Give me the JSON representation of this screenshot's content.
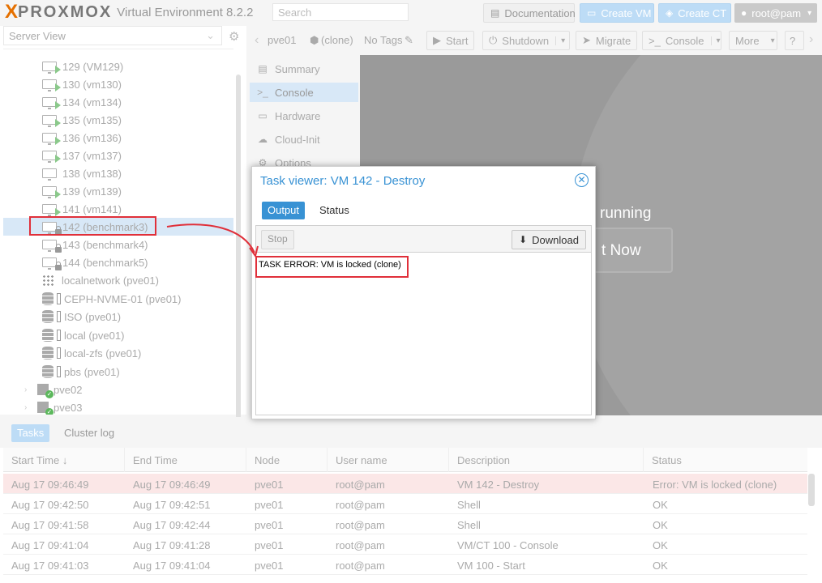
{
  "header": {
    "logo_x": "X",
    "logo_brand": "PROXMOX",
    "product": "Virtual Environment 8.2.2",
    "search_placeholder": "Search",
    "documentation": "Documentation",
    "create_vm": "Create VM",
    "create_ct": "Create CT",
    "user": "root@pam"
  },
  "sidebar": {
    "view": "Server View",
    "rows": [
      {
        "label": "129 (VM129)",
        "icon": "vm-running"
      },
      {
        "label": "130 (vm130)",
        "icon": "vm-running"
      },
      {
        "label": "134 (vm134)",
        "icon": "vm-running"
      },
      {
        "label": "135 (vm135)",
        "icon": "vm-running"
      },
      {
        "label": "136 (vm136)",
        "icon": "vm-running"
      },
      {
        "label": "137 (vm137)",
        "icon": "vm-running"
      },
      {
        "label": "138 (vm138)",
        "icon": "vm-stopped"
      },
      {
        "label": "139 (vm139)",
        "icon": "vm-running"
      },
      {
        "label": "141 (vm141)",
        "icon": "vm-running"
      },
      {
        "label": "142 (benchmark3)",
        "icon": "vm-locked"
      },
      {
        "label": "143 (benchmark4)",
        "icon": "vm-locked"
      },
      {
        "label": "144 (benchmark5)",
        "icon": "vm-locked"
      },
      {
        "label": "localnetwork (pve01)",
        "icon": "network"
      },
      {
        "label": "CEPH-NVME-01 (pve01)",
        "icon": "storage"
      },
      {
        "label": "ISO (pve01)",
        "icon": "storage"
      },
      {
        "label": "local (pve01)",
        "icon": "storage"
      },
      {
        "label": "local-zfs (pve01)",
        "icon": "storage"
      },
      {
        "label": "pbs (pve01)",
        "icon": "storage"
      },
      {
        "label": "pve02",
        "icon": "server"
      },
      {
        "label": "pve03",
        "icon": "server"
      }
    ]
  },
  "vm_header": {
    "name": "pve01",
    "tag_clone": "(clone)",
    "no_tags": "No Tags",
    "start": "Start",
    "shutdown": "Shutdown",
    "migrate": "Migrate",
    "console": "Console",
    "more": "More"
  },
  "vm_nav": {
    "items": [
      "Summary",
      "Console",
      "Hardware",
      "Cloud-Init",
      "Options"
    ]
  },
  "console": {
    "running_text": "running",
    "start_now": "t Now"
  },
  "dialog": {
    "title": "Task viewer: VM 142 - Destroy",
    "tab_output": "Output",
    "tab_status": "Status",
    "stop": "Stop",
    "download": "Download",
    "output_text": "TASK ERROR: VM is locked (clone)"
  },
  "tasks": {
    "tab_tasks": "Tasks",
    "tab_cluster": "Cluster log",
    "columns": [
      "Start Time ↓",
      "End Time",
      "Node",
      "User name",
      "Description",
      "Status"
    ],
    "rows": [
      {
        "start": "Aug 17 09:46:49",
        "end": "Aug 17 09:46:49",
        "node": "pve01",
        "user": "root@pam",
        "desc": "VM 142 - Destroy",
        "status": "Error: VM is locked (clone)"
      },
      {
        "start": "Aug 17 09:42:50",
        "end": "Aug 17 09:42:51",
        "node": "pve01",
        "user": "root@pam",
        "desc": "Shell",
        "status": "OK"
      },
      {
        "start": "Aug 17 09:41:58",
        "end": "Aug 17 09:42:44",
        "node": "pve01",
        "user": "root@pam",
        "desc": "Shell",
        "status": "OK"
      },
      {
        "start": "Aug 17 09:41:04",
        "end": "Aug 17 09:41:28",
        "node": "pve01",
        "user": "root@pam",
        "desc": "VM/CT 100 - Console",
        "status": "OK"
      },
      {
        "start": "Aug 17 09:41:03",
        "end": "Aug 17 09:41:04",
        "node": "pve01",
        "user": "root@pam",
        "desc": "VM 100 - Start",
        "status": "OK"
      }
    ]
  },
  "colors": {
    "accent": "#3892d4",
    "highlight": "#e0303a",
    "brand": "#e57000"
  }
}
